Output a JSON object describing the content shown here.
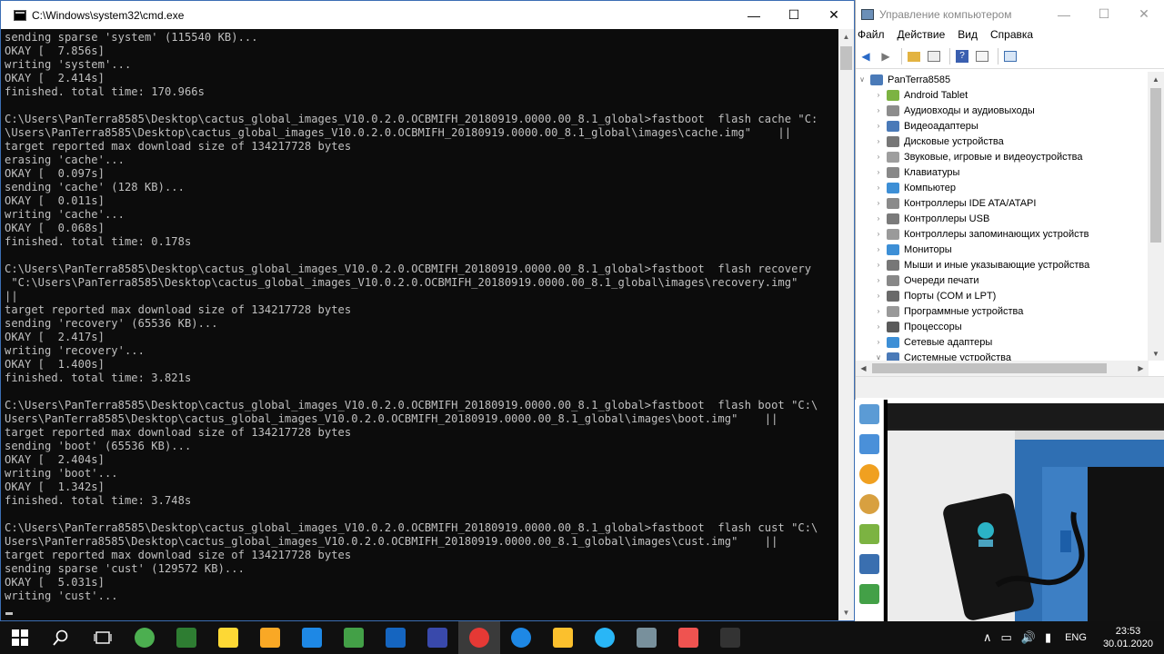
{
  "cmd": {
    "title": "C:\\Windows\\system32\\cmd.exe",
    "lines": [
      "sending sparse 'system' (115540 KB)...",
      "OKAY [  7.856s]",
      "writing 'system'...",
      "OKAY [  2.414s]",
      "finished. total time: 170.966s",
      "",
      "C:\\Users\\PanTerra8585\\Desktop\\cactus_global_images_V10.0.2.0.OCBMIFH_20180919.0000.00_8.1_global>fastboot  flash cache \"C:",
      "\\Users\\PanTerra8585\\Desktop\\cactus_global_images_V10.0.2.0.OCBMIFH_20180919.0000.00_8.1_global\\images\\cache.img\"    ||",
      "target reported max download size of 134217728 bytes",
      "erasing 'cache'...",
      "OKAY [  0.097s]",
      "sending 'cache' (128 KB)...",
      "OKAY [  0.011s]",
      "writing 'cache'...",
      "OKAY [  0.068s]",
      "finished. total time: 0.178s",
      "",
      "C:\\Users\\PanTerra8585\\Desktop\\cactus_global_images_V10.0.2.0.OCBMIFH_20180919.0000.00_8.1_global>fastboot  flash recovery",
      " \"C:\\Users\\PanTerra8585\\Desktop\\cactus_global_images_V10.0.2.0.OCBMIFH_20180919.0000.00_8.1_global\\images\\recovery.img\"",
      "||",
      "target reported max download size of 134217728 bytes",
      "sending 'recovery' (65536 KB)...",
      "OKAY [  2.417s]",
      "writing 'recovery'...",
      "OKAY [  1.400s]",
      "finished. total time: 3.821s",
      "",
      "C:\\Users\\PanTerra8585\\Desktop\\cactus_global_images_V10.0.2.0.OCBMIFH_20180919.0000.00_8.1_global>fastboot  flash boot \"C:\\",
      "Users\\PanTerra8585\\Desktop\\cactus_global_images_V10.0.2.0.OCBMIFH_20180919.0000.00_8.1_global\\images\\boot.img\"    ||",
      "target reported max download size of 134217728 bytes",
      "sending 'boot' (65536 KB)...",
      "OKAY [  2.404s]",
      "writing 'boot'...",
      "OKAY [  1.342s]",
      "finished. total time: 3.748s",
      "",
      "C:\\Users\\PanTerra8585\\Desktop\\cactus_global_images_V10.0.2.0.OCBMIFH_20180919.0000.00_8.1_global>fastboot  flash cust \"C:\\",
      "Users\\PanTerra8585\\Desktop\\cactus_global_images_V10.0.2.0.OCBMIFH_20180919.0000.00_8.1_global\\images\\cust.img\"    ||",
      "target reported max download size of 134217728 bytes",
      "sending sparse 'cust' (129572 KB)...",
      "OKAY [  5.031s]",
      "writing 'cust'..."
    ]
  },
  "mgmt": {
    "title": "Управление компьютером",
    "menu": [
      "Файл",
      "Действие",
      "Вид",
      "Справка"
    ],
    "root": "PanTerra8585",
    "devices": [
      {
        "label": "Android Tablet",
        "color": "#7cb342"
      },
      {
        "label": "Аудиовходы и аудиовыходы",
        "color": "#8d8d8d"
      },
      {
        "label": "Видеоадаптеры",
        "color": "#4a7ab8"
      },
      {
        "label": "Дисковые устройства",
        "color": "#777777"
      },
      {
        "label": "Звуковые, игровые и видеоустройства",
        "color": "#9e9e9e"
      },
      {
        "label": "Клавиатуры",
        "color": "#888888"
      },
      {
        "label": "Компьютер",
        "color": "#3d8fd6"
      },
      {
        "label": "Контроллеры IDE ATA/ATAPI",
        "color": "#8a8a8a"
      },
      {
        "label": "Контроллеры USB",
        "color": "#7a7a7a"
      },
      {
        "label": "Контроллеры запоминающих устройств",
        "color": "#9a9a9a"
      },
      {
        "label": "Мониторы",
        "color": "#3d8fd6"
      },
      {
        "label": "Мыши и иные указывающие устройства",
        "color": "#777777"
      },
      {
        "label": "Очереди печати",
        "color": "#888888"
      },
      {
        "label": "Порты (COM и LPT)",
        "color": "#6a6a6a"
      },
      {
        "label": "Программные устройства",
        "color": "#999999"
      },
      {
        "label": "Процессоры",
        "color": "#5a5a5a"
      },
      {
        "label": "Сетевые адаптеры",
        "color": "#3d8fd6"
      },
      {
        "label": "Системные устройства",
        "color": "#4a7ab8"
      }
    ]
  },
  "tray": {
    "lang": "ENG",
    "time": "23:53",
    "date": "30.01.2020"
  },
  "taskbar": {
    "apps": [
      {
        "name": "utorrent",
        "color": "#4caf50"
      },
      {
        "name": "user-app",
        "color": "#2e7d32"
      },
      {
        "name": "player",
        "color": "#fdd835"
      },
      {
        "name": "warning-app",
        "color": "#f9a825"
      },
      {
        "name": "globe-app",
        "color": "#1e88e5"
      },
      {
        "name": "c-app",
        "color": "#43a047"
      },
      {
        "name": "m-app",
        "color": "#1565c0"
      },
      {
        "name": "save-app",
        "color": "#3949ab"
      },
      {
        "name": "chrome",
        "color": "#e53935"
      },
      {
        "name": "edge",
        "color": "#1e88e5"
      },
      {
        "name": "explorer",
        "color": "#fbc02d"
      },
      {
        "name": "telegram",
        "color": "#29b6f6"
      },
      {
        "name": "network-app",
        "color": "#78909c"
      },
      {
        "name": "c-red-app",
        "color": "#ef5350"
      },
      {
        "name": "cmd",
        "color": "#333333"
      }
    ]
  }
}
